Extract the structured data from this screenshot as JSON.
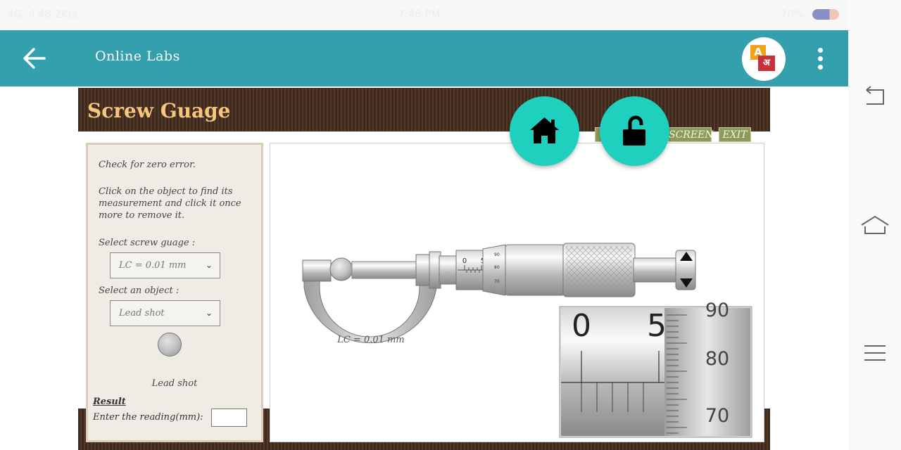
{
  "status_bar": {
    "left": "4G .ıl 48.2K/s",
    "time": "7:46 PM",
    "right": "70%"
  },
  "app_bar": {
    "title": "Online Labs",
    "lang_badge_top": "A",
    "lang_badge_bottom": "अ"
  },
  "lab": {
    "title": "Screw Guage",
    "header_buttons": [
      "SCREEN",
      "EXIT"
    ],
    "instructions": {
      "zero_error": "Check for zero error.",
      "click_object": "Click on the object to find its measurement and click it once more to remove it."
    },
    "select_gauge_label": "Select screw guage :",
    "select_gauge_value": "LC = 0.01 mm",
    "select_object_label": "Select an object :",
    "select_object_value": "Lead shot",
    "object_name": "Lead shot",
    "result_label": "Result",
    "reading_label": "Enter the reading(mm):",
    "reading_value": ""
  },
  "instrument": {
    "frame_label": "LC = 0.01 mm",
    "sleeve_marks": [
      "0",
      "5"
    ],
    "thimble_small": [
      "90",
      "80",
      "70"
    ],
    "zoom": {
      "sleeve_marks": [
        "0",
        "5"
      ],
      "thimble_marks": [
        "90",
        "80",
        "70"
      ]
    }
  },
  "fabs": {
    "home": "home-icon",
    "lock": "unlock-icon"
  },
  "colors": {
    "app_bar": "#35a0ad",
    "fab": "#1fd0be",
    "title": "#f6c57e",
    "header_bg": "#3d2a1d",
    "tag_button": "#8c9a5a"
  }
}
